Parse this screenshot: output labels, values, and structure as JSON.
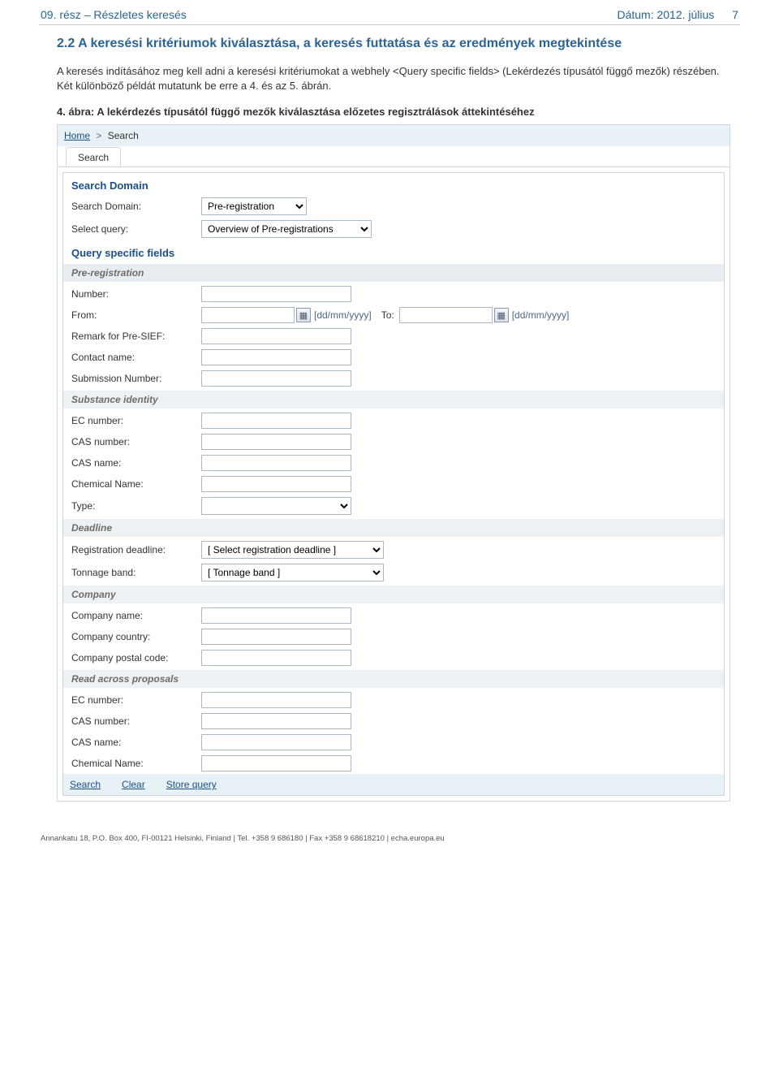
{
  "header": {
    "left": "09. rész – Részletes keresés",
    "right_label": "Dátum: 2012. július",
    "page_no": "7"
  },
  "section": {
    "title": "2.2 A keresési kritériumok kiválasztása, a keresés futtatása és az eredmények megtekintése",
    "para": "A keresés indításához meg kell adni a keresési kritériumokat a webhely <Query specific fields> (Lekérdezés típusától függő mezők) részében. Két különböző példát mutatunk be erre a 4. és az 5. ábrán.",
    "figcap": "4. ábra: A lekérdezés típusától függő mezők kiválasztása előzetes regisztrálások áttekintéséhez"
  },
  "app": {
    "breadcrumb": {
      "home": "Home",
      "sep": ">",
      "current": "Search"
    },
    "tab": "Search",
    "search_domain_title": "Search Domain",
    "labels": {
      "search_domain": "Search Domain:",
      "select_query": "Select query:"
    },
    "search_domain_value": "Pre-registration",
    "select_query_value": "Overview of Pre-registrations",
    "qsf_title": "Query specific fields",
    "groups": {
      "prereg": "Pre-registration",
      "subst": "Substance identity",
      "deadline": "Deadline",
      "company": "Company",
      "rap": "Read across proposals"
    },
    "fields": {
      "number": "Number:",
      "from": "From:",
      "to": "To:",
      "date_hint": "[dd/mm/yyyy]",
      "remark": "Remark for Pre-SIEF:",
      "contact": "Contact name:",
      "subno": "Submission Number:",
      "ec": "EC number:",
      "cas": "CAS number:",
      "casname": "CAS name:",
      "chemname": "Chemical Name:",
      "type": "Type:",
      "regdeadline": "Registration deadline:",
      "regdeadline_val": "[ Select registration deadline ]",
      "tonnage": "Tonnage band:",
      "tonnage_val": "[ Tonnage band ]",
      "coname": "Company name:",
      "cocountry": "Company country:",
      "copostal": "Company postal code:"
    },
    "buttons": {
      "search": "Search",
      "clear": "Clear",
      "store": "Store query"
    }
  },
  "footer": "Annankatu 18, P.O. Box 400, FI-00121 Helsinki, Finland | Tel. +358 9 686180 | Fax +358 9 68618210 | echa.europa.eu"
}
